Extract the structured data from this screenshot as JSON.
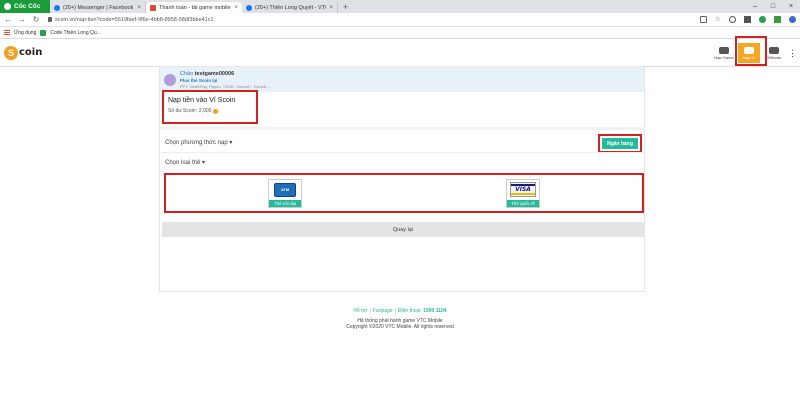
{
  "browser": {
    "name": "Cốc Cốc",
    "tabs": [
      {
        "title": "(20+) Messenger | Facebook",
        "active": false,
        "icon": "facebook-icon"
      },
      {
        "title": "Thanh toán - tải game mobile",
        "active": true,
        "icon": "scoin-icon"
      },
      {
        "title": "(20+) Thiên Long Quyết - VTC",
        "active": false,
        "icon": "facebook-icon"
      }
    ],
    "url": "scoin.vn/nap-tien?code=5519faef-9f6e-4bb8-8958-58df3bbe41c1",
    "bookmarks": [
      {
        "label": "Ứng dụng",
        "icon": "apps-grid-icon"
      },
      {
        "label": "Code Thiên Long Qu...",
        "icon": "bookmark-icon"
      }
    ]
  },
  "site": {
    "logo_text": "coin",
    "logo_coin": "S",
    "header_items": [
      {
        "label": "Nạp Game",
        "icon": "gamepad-icon"
      },
      {
        "label": "Nạp Ví",
        "icon": "wallet-icon",
        "highlighted": true
      },
      {
        "label": "Giftcode",
        "icon": "gift-icon"
      }
    ]
  },
  "user": {
    "greeting_prefix": "Chào",
    "username": "testgame00006",
    "promo": "Plus thẻ Scoin lại",
    "payment_methods": "FPT, ViettelPay, Payoo, TGDD, Vnmart+, Circlek ..."
  },
  "wallet": {
    "title": "Nạp tiền vào Ví Scoin",
    "balance_label": "Số dư Scoin:",
    "balance_value": "2,000"
  },
  "form": {
    "method_label": "Chọn phương thức nạp",
    "bank_button": "Ngân hàng",
    "card_type_label": "Chọn loại thẻ",
    "cards": [
      {
        "label": "Thẻ nội địa",
        "icon": "atm-card-icon",
        "badge": "ATM"
      },
      {
        "label": "Thẻ quốc tế",
        "icon": "visa-card-icon",
        "badge": "VISA"
      }
    ],
    "back_button": "Quay lại"
  },
  "footer": {
    "support": "Hỗ trợ",
    "fanpage": "Fanpage",
    "phone_label": "Điện thoại:",
    "phone": "1900 1104",
    "publisher": "Hệ thống phát hành game VTC Mobile",
    "copyright": "Copyright ©2020 VTC Mobile. All rights reserved"
  },
  "colors": {
    "accent": "#26b99a",
    "wallet_highlight": "#f5a623",
    "annotation_red": "#d62020"
  }
}
